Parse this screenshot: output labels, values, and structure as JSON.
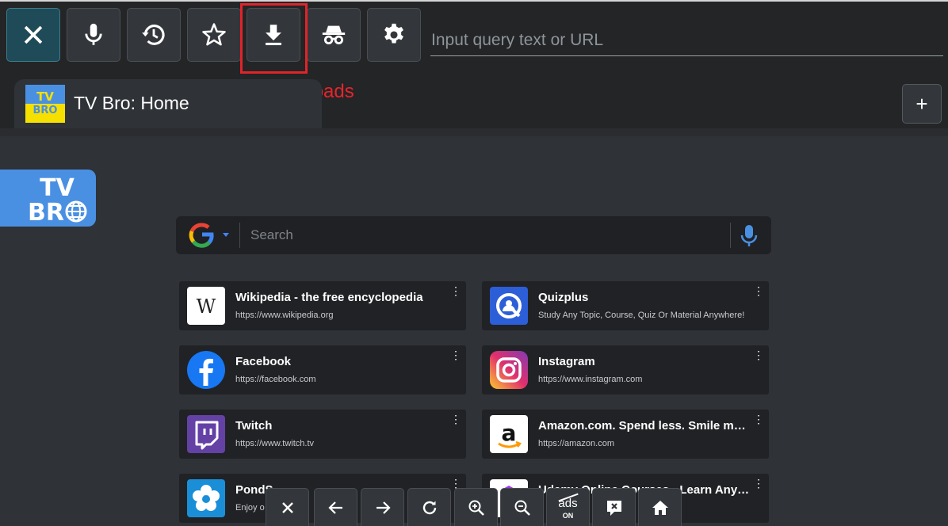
{
  "toolbar": {
    "buttons": [
      {
        "name": "close-button",
        "icon": "close-icon"
      },
      {
        "name": "voice-search-button",
        "icon": "microphone-icon"
      },
      {
        "name": "history-button",
        "icon": "history-icon"
      },
      {
        "name": "favorites-button",
        "icon": "star-icon"
      },
      {
        "name": "downloads-button",
        "icon": "download-icon"
      },
      {
        "name": "incognito-button",
        "icon": "incognito-icon"
      },
      {
        "name": "settings-button",
        "icon": "gear-icon"
      }
    ],
    "url_placeholder": "Input query text or URL"
  },
  "annotation": {
    "label": "Downloads",
    "color": "#e0242a"
  },
  "tab": {
    "title": "TV Bro: Home",
    "favicon": "tv-bro-icon"
  },
  "new_tab_label": "+",
  "search": {
    "placeholder": "Search",
    "engine_icon": "google-icon"
  },
  "shortcuts": [
    {
      "title": "Wikipedia - the free encyclopedia",
      "url": "https://www.wikipedia.org",
      "icon": "wikipedia-icon"
    },
    {
      "title": "Quizplus",
      "url": "Study Any Topic, Course, Quiz Or Material Anywhere!",
      "icon": "quizplus-icon"
    },
    {
      "title": "Facebook",
      "url": "https://facebook.com",
      "icon": "facebook-icon"
    },
    {
      "title": "Instagram",
      "url": "https://www.instagram.com",
      "icon": "instagram-icon"
    },
    {
      "title": "Twitch",
      "url": "https://www.twitch.tv",
      "icon": "twitch-icon"
    },
    {
      "title": "Amazon.com. Spend less. Smile more.",
      "url": "https://amazon.com",
      "icon": "amazon-icon"
    },
    {
      "title": "PondS",
      "url": "Enjoy o",
      "icon": "ponds-icon"
    },
    {
      "title": "Udemy Online Courses - Learn Anything",
      "url": "",
      "icon": "udemy-icon"
    }
  ],
  "bottom_bar": {
    "ads_label": "ads",
    "ads_state": "ON",
    "buttons": [
      "close-icon",
      "back-icon",
      "forward-icon",
      "refresh-icon",
      "zoom-in-icon",
      "zoom-out-icon",
      "ads-toggle",
      "close-tab-icon",
      "home-icon"
    ]
  },
  "colors": {
    "accent": "#1f4a57",
    "background": "#2f3236",
    "card": "#202225",
    "highlight": "#e0242a",
    "tvbro_blue": "#4a90e2"
  }
}
